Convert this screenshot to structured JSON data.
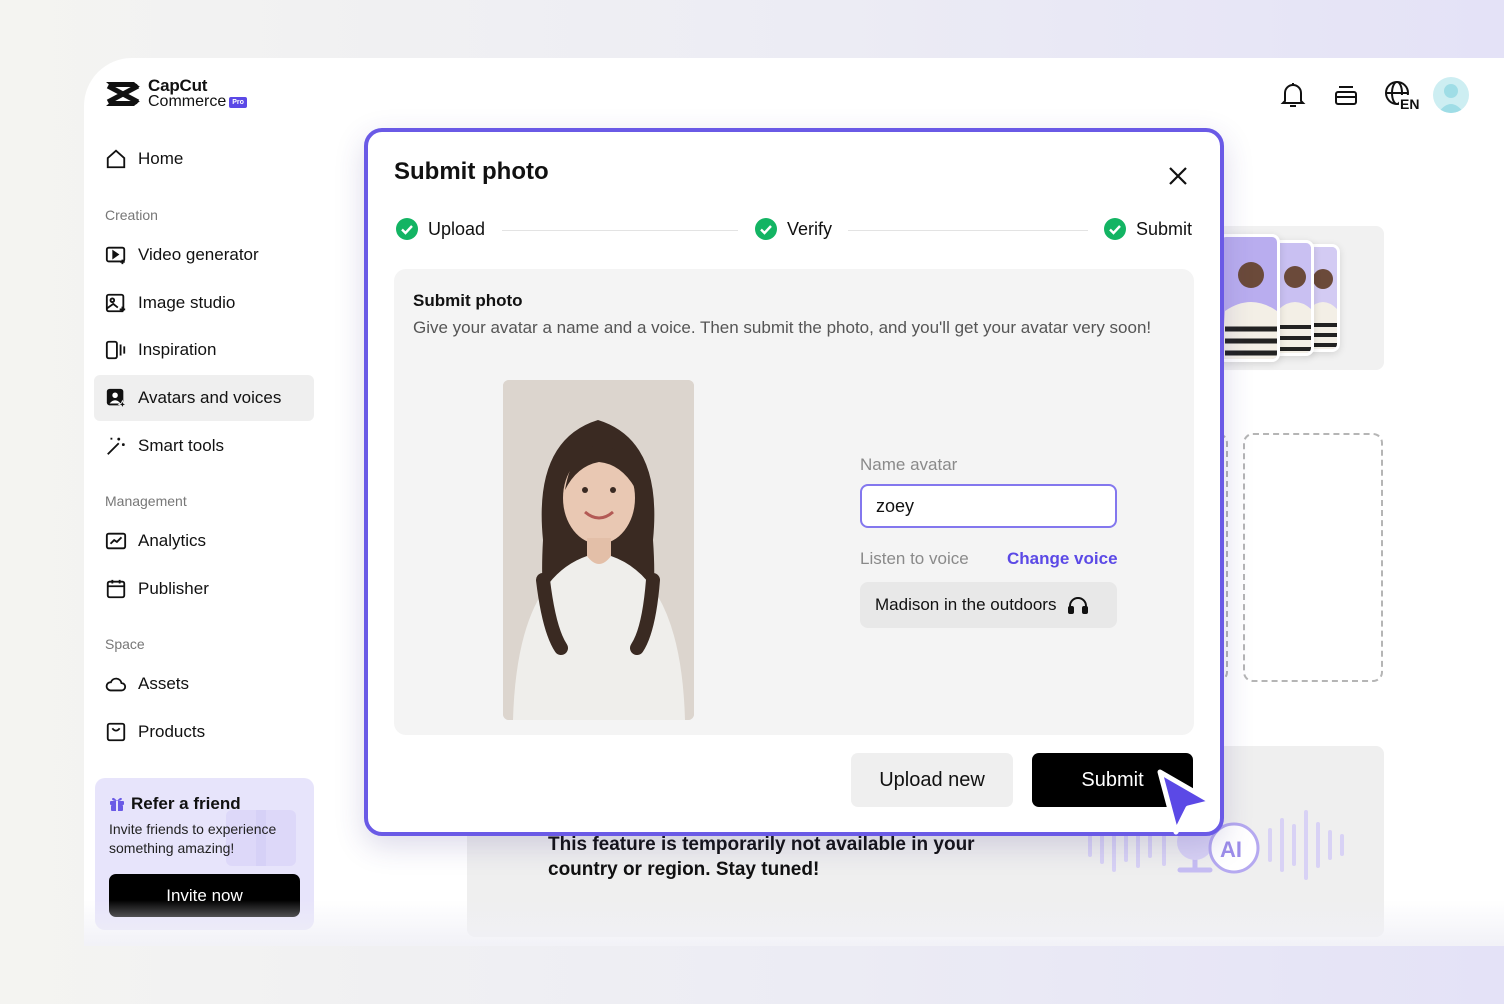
{
  "brand": {
    "line1": "CapCut",
    "line2": "Commerce",
    "badge": "Pro"
  },
  "sidebar": {
    "home": "Home",
    "sections": [
      {
        "label": "Creation",
        "items": [
          "Video generator",
          "Image studio",
          "Inspiration",
          "Avatars and voices",
          "Smart tools"
        ]
      },
      {
        "label": "Management",
        "items": [
          "Analytics",
          "Publisher"
        ]
      },
      {
        "label": "Space",
        "items": [
          "Assets",
          "Products"
        ]
      }
    ],
    "active_item": "Avatars and voices",
    "refer": {
      "title": "Refer a friend",
      "description": "Invite friends to experience something amazing!",
      "button": "Invite now"
    }
  },
  "header": {
    "icons": [
      "bell-icon",
      "layers-icon",
      "language-icon",
      "user-avatar"
    ],
    "language_code": "EN"
  },
  "background": {
    "unavailable_message": "This feature is temporarily not available in your country or region. Stay tuned!",
    "ai_badge": "AI"
  },
  "modal": {
    "title": "Submit photo",
    "steps": [
      {
        "label": "Upload",
        "status": "complete"
      },
      {
        "label": "Verify",
        "status": "complete"
      },
      {
        "label": "Submit",
        "status": "complete"
      }
    ],
    "section_title": "Submit photo",
    "section_description": "Give your avatar a name and a voice. Then submit the photo, and you'll get your avatar very soon!",
    "name_label": "Name avatar",
    "name_value": "zoey",
    "voice_label": "Listen to voice",
    "change_voice": "Change voice",
    "voice_value": "Madison in the outdoors",
    "buttons": {
      "upload_new": "Upload new",
      "submit": "Submit"
    }
  },
  "colors": {
    "accent": "#5b49e6",
    "modal_border": "#6a5ae6",
    "step_complete": "#13b463",
    "primary_button": "#000000"
  }
}
